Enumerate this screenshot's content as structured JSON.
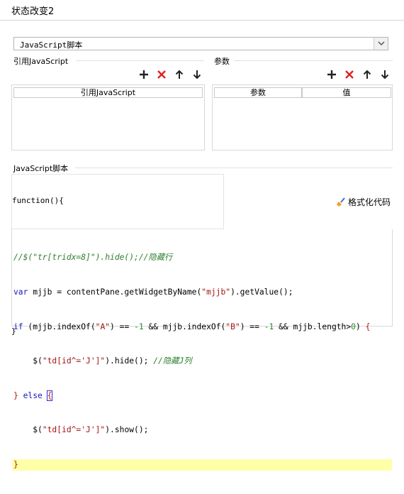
{
  "dialog": {
    "title": "状态改变2"
  },
  "script_type": {
    "selected": "JavaScript脚本"
  },
  "ref_js": {
    "label": "引用JavaScript",
    "column": "引用JavaScript"
  },
  "params": {
    "label": "参数",
    "columns": [
      "参数",
      "值"
    ]
  },
  "toolbar_icons": [
    "add-icon",
    "delete-icon",
    "move-up-icon",
    "move-down-icon"
  ],
  "script_section": {
    "label": "JavaScript脚本",
    "function_header": "function(){",
    "format_button": "格式化代码",
    "closing": "}"
  },
  "code_lines": [
    "//$(\"tr[tridx=8]\").hide();//隐藏行",
    "var mjjb = contentPane.getWidgetByName(\"mjjb\").getValue();",
    "if (mjjb.indexOf(\"A\") == -1 && mjjb.indexOf(\"B\") == -1 && mjjb.length>0) {",
    "    $(\"td[id^='J']\").hide(); //隐藏J列",
    "} else {",
    "    $(\"td[id^='J']\").show();",
    "}"
  ],
  "colors": {
    "add": "#222222",
    "delete": "#e02020",
    "comment": "#2c7d2c",
    "keyword": "#1717b8",
    "string": "#a31515",
    "current_line": "#ffffa8"
  }
}
